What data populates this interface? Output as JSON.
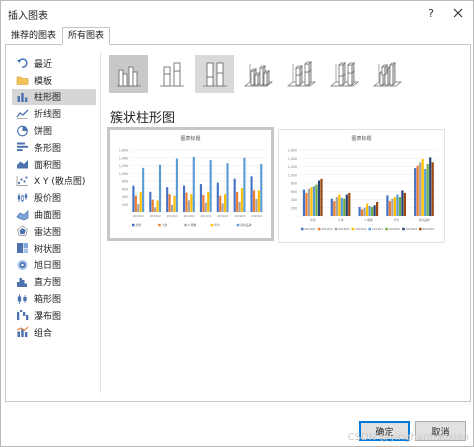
{
  "window": {
    "title": "插入图表"
  },
  "tabs": [
    {
      "label": "推荐的图表",
      "active": false
    },
    {
      "label": "所有图表",
      "active": true
    }
  ],
  "sidebar": {
    "items": [
      {
        "label": "最近",
        "icon": "undo-arrow-icon"
      },
      {
        "label": "模板",
        "icon": "folder-icon"
      },
      {
        "label": "柱形图",
        "icon": "column-chart-icon",
        "selected": true
      },
      {
        "label": "折线图",
        "icon": "line-chart-icon"
      },
      {
        "label": "饼图",
        "icon": "pie-chart-icon"
      },
      {
        "label": "条形图",
        "icon": "bar-chart-icon"
      },
      {
        "label": "面积图",
        "icon": "area-chart-icon"
      },
      {
        "label": "X Y (散点图)",
        "icon": "scatter-chart-icon"
      },
      {
        "label": "股价图",
        "icon": "stock-chart-icon"
      },
      {
        "label": "曲面图",
        "icon": "surface-chart-icon"
      },
      {
        "label": "雷达图",
        "icon": "radar-chart-icon"
      },
      {
        "label": "树状图",
        "icon": "treemap-chart-icon"
      },
      {
        "label": "旭日图",
        "icon": "sunburst-chart-icon"
      },
      {
        "label": "直方图",
        "icon": "histogram-chart-icon"
      },
      {
        "label": "箱形图",
        "icon": "box-whisker-chart-icon"
      },
      {
        "label": "瀑布图",
        "icon": "waterfall-chart-icon"
      },
      {
        "label": "组合",
        "icon": "combo-chart-icon"
      }
    ]
  },
  "subtypes": [
    {
      "icon": "clustered-column-icon",
      "state": "selected"
    },
    {
      "icon": "stacked-column-icon",
      "state": "normal"
    },
    {
      "icon": "percent-stacked-column-icon",
      "state": "hover"
    },
    {
      "icon": "3d-clustered-column-icon",
      "state": "normal"
    },
    {
      "icon": "3d-stacked-column-icon",
      "state": "normal"
    },
    {
      "icon": "3d-percent-stacked-column-icon",
      "state": "normal"
    },
    {
      "icon": "3d-column-icon",
      "state": "normal"
    }
  ],
  "chart_heading": "簇状柱形图",
  "chart_data": [
    {
      "type": "bar",
      "title": "图表标题",
      "categories": [
        "2019Q1",
        "2019Q2",
        "2019Q3",
        "2019Q4",
        "2019Q1",
        "2019Q2",
        "2019Q3",
        "2019Q4"
      ],
      "series": [
        {
          "name": "新增",
          "values": [
            680,
            520,
            640,
            680,
            720,
            760,
            860,
            920
          ]
        },
        {
          "name": "小米",
          "values": [
            420,
            320,
            460,
            500,
            440,
            420,
            520,
            560
          ]
        },
        {
          "name": "X 图像",
          "values": [
            200,
            120,
            180,
            300,
            240,
            220,
            260,
            340
          ]
        },
        {
          "name": "华为",
          "values": [
            520,
            300,
            420,
            460,
            520,
            460,
            620,
            560
          ]
        },
        {
          "name": "海外品牌",
          "values": [
            1140,
            1220,
            1380,
            1420,
            1340,
            1260,
            1400,
            1240
          ]
        }
      ],
      "y_ticks": [
        "1,600",
        "1,400",
        "1,200",
        "1,000",
        "800",
        "600",
        "400",
        "200",
        "-"
      ],
      "ylim": [
        0,
        1600
      ],
      "legend": "bottom"
    },
    {
      "type": "bar",
      "title": "图表标题",
      "categories": [
        "新增",
        "小米",
        "X 图像",
        "华为",
        "海外品牌"
      ],
      "series": [
        {
          "name": "2019Q1",
          "values": [
            640,
            420,
            220,
            500,
            1160
          ]
        },
        {
          "name": "2019Q2",
          "values": [
            560,
            360,
            160,
            360,
            1220
          ]
        },
        {
          "name": "2019Q3",
          "values": [
            660,
            460,
            200,
            420,
            1300
          ]
        },
        {
          "name": "2019Q4",
          "values": [
            700,
            520,
            300,
            460,
            1380
          ]
        },
        {
          "name": "2019Q1",
          "values": [
            720,
            440,
            240,
            520,
            1140
          ]
        },
        {
          "name": "2019Q2",
          "values": [
            760,
            420,
            220,
            460,
            1260
          ]
        },
        {
          "name": "2019Q3",
          "values": [
            860,
            520,
            260,
            620,
            1420
          ]
        },
        {
          "name": "2019Q4",
          "values": [
            900,
            560,
            340,
            560,
            1300
          ]
        }
      ],
      "y_ticks": [
        "1,600",
        "1,400",
        "1,200",
        "1,000",
        "800",
        "600",
        "400",
        "200",
        "-"
      ],
      "ylim": [
        0,
        1600
      ],
      "legend": "bottom"
    }
  ],
  "colors": {
    "series_a": [
      "#4472c4",
      "#ed7d31",
      "#a5a5a5",
      "#ffc000",
      "#5b9bd5"
    ],
    "series_b": [
      "#4472c4",
      "#ed7d31",
      "#a5a5a5",
      "#ffc000",
      "#5b9bd5",
      "#70ad47",
      "#264478",
      "#9e480e"
    ],
    "selected_bg": "#d6d6d6",
    "primary_button_border": "#0078d7"
  },
  "buttons": {
    "ok": "确定",
    "cancel": "取消"
  },
  "watermark": "CSDN @yinghanhaoxian"
}
